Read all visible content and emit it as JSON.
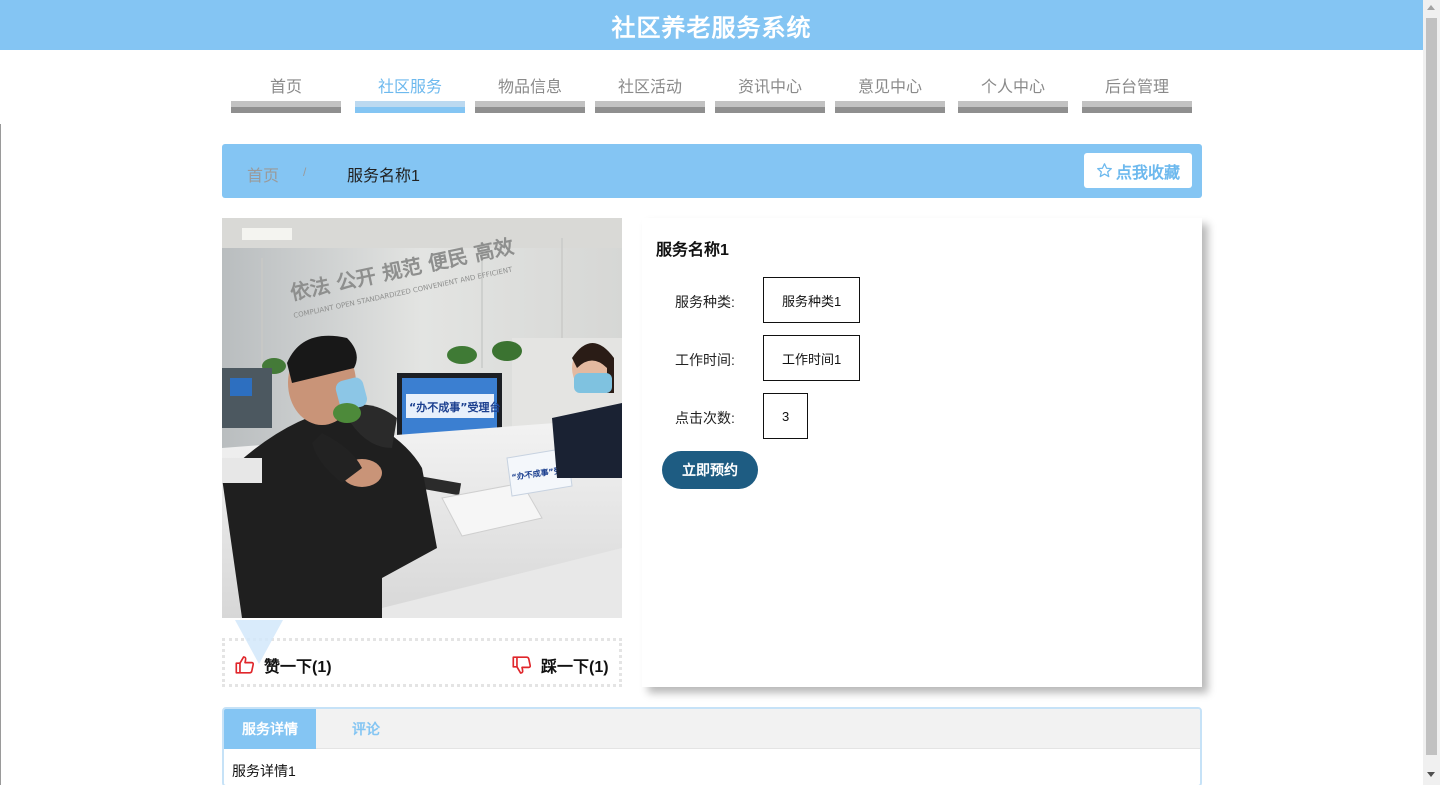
{
  "header": {
    "title": "社区养老服务系统"
  },
  "nav": {
    "items": [
      {
        "label": "首页",
        "active": false
      },
      {
        "label": "社区服务",
        "active": true
      },
      {
        "label": "物品信息",
        "active": false
      },
      {
        "label": "社区活动",
        "active": false
      },
      {
        "label": "资讯中心",
        "active": false
      },
      {
        "label": "意见中心",
        "active": false
      },
      {
        "label": "个人中心",
        "active": false
      },
      {
        "label": "后台管理",
        "active": false
      }
    ]
  },
  "breadcrumb": {
    "home": "首页",
    "separator": "/",
    "current": "服务名称1"
  },
  "favorite": {
    "label": "点我收藏",
    "icon": "star-outline-icon"
  },
  "vote": {
    "like_label": "赞一下(1)",
    "like_icon": "thumbs-up-icon",
    "dislike_label": "踩一下(1)",
    "dislike_icon": "thumbs-down-icon"
  },
  "detail": {
    "title": "服务名称1",
    "fields": [
      {
        "label": "服务种类:",
        "value": "服务种类1"
      },
      {
        "label": "工作时间:",
        "value": "工作时间1"
      },
      {
        "label": "点击次数:",
        "value": "3"
      }
    ],
    "book_label": "立即预约"
  },
  "tabs": {
    "items": [
      {
        "label": "服务详情",
        "active": true
      },
      {
        "label": "评论",
        "active": false
      }
    ],
    "content": "服务详情1"
  },
  "photo": {
    "wall_text": "依法 公开 规范 便民 高效",
    "wall_subtext": "COMPLIANT OPEN STANDARDIZED CONVENIENT AND EFFICIENT",
    "screen_text": "“办不成事”受理台",
    "sign_text": "“办不成事”受理台"
  },
  "colors": {
    "primary": "#84c5f3",
    "button_dark": "#1e5c82",
    "vote_red": "#e0262b",
    "nav_text": "#8a8a8a"
  }
}
